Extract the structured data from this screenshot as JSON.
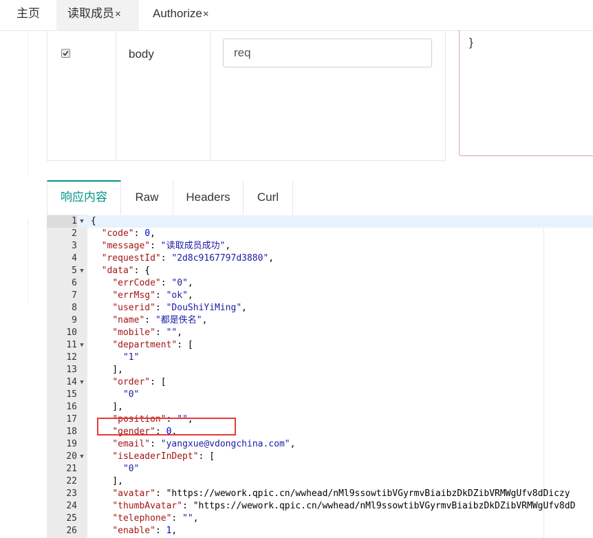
{
  "top_tabs": [
    {
      "label": "主页",
      "closable": false
    },
    {
      "label": "读取成员",
      "closable": true
    },
    {
      "label": "Authorize",
      "closable": true
    }
  ],
  "close_glyph": "×",
  "params": {
    "checked": true,
    "name": "body",
    "value": "req"
  },
  "body_box_text": "}",
  "response_tabs": [
    "响应内容",
    "Raw",
    "Headers",
    "Curl"
  ],
  "accent_color": "#009688",
  "code_lines": [
    {
      "n": "1",
      "fold": true,
      "text": "{"
    },
    {
      "n": "2",
      "text": "  \"code\": 0,"
    },
    {
      "n": "3",
      "text": "  \"message\": \"读取成员成功\","
    },
    {
      "n": "4",
      "text": "  \"requestId\": \"2d8c9167797d3880\","
    },
    {
      "n": "5",
      "fold": true,
      "text": "  \"data\": {"
    },
    {
      "n": "6",
      "text": "    \"errCode\": \"0\","
    },
    {
      "n": "7",
      "text": "    \"errMsg\": \"ok\","
    },
    {
      "n": "8",
      "text": "    \"userid\": \"DouShiYiMing\","
    },
    {
      "n": "9",
      "text": "    \"name\": \"都是佚名\","
    },
    {
      "n": "10",
      "text": "    \"mobile\": \"\","
    },
    {
      "n": "11",
      "fold": true,
      "text": "    \"department\": ["
    },
    {
      "n": "12",
      "text": "      \"1\""
    },
    {
      "n": "13",
      "text": "    ],"
    },
    {
      "n": "14",
      "fold": true,
      "text": "    \"order\": ["
    },
    {
      "n": "15",
      "text": "      \"0\""
    },
    {
      "n": "16",
      "text": "    ],"
    },
    {
      "n": "17",
      "text": "    \"position\": \"\","
    },
    {
      "n": "18",
      "text": "    \"gender\": 0,"
    },
    {
      "n": "19",
      "text": "    \"email\": \"yangxue@vdongchina.com\","
    },
    {
      "n": "20",
      "fold": true,
      "text": "    \"isLeaderInDept\": ["
    },
    {
      "n": "21",
      "text": "      \"0\""
    },
    {
      "n": "22",
      "text": "    ],"
    },
    {
      "n": "23",
      "text": "    \"avatar\": \"https://wework.qpic.cn/wwhead/nMl9ssowtibVGyrmvBiaibzDkDZibVRMWgUfv8dDiczy"
    },
    {
      "n": "24",
      "text": "    \"thumbAvatar\": \"https://wework.qpic.cn/wwhead/nMl9ssowtibVGyrmvBiaibzDkDZibVRMWgUfv8dD"
    },
    {
      "n": "25",
      "text": "    \"telephone\": \"\","
    },
    {
      "n": "26",
      "text": "    \"enable\": 1,"
    }
  ]
}
